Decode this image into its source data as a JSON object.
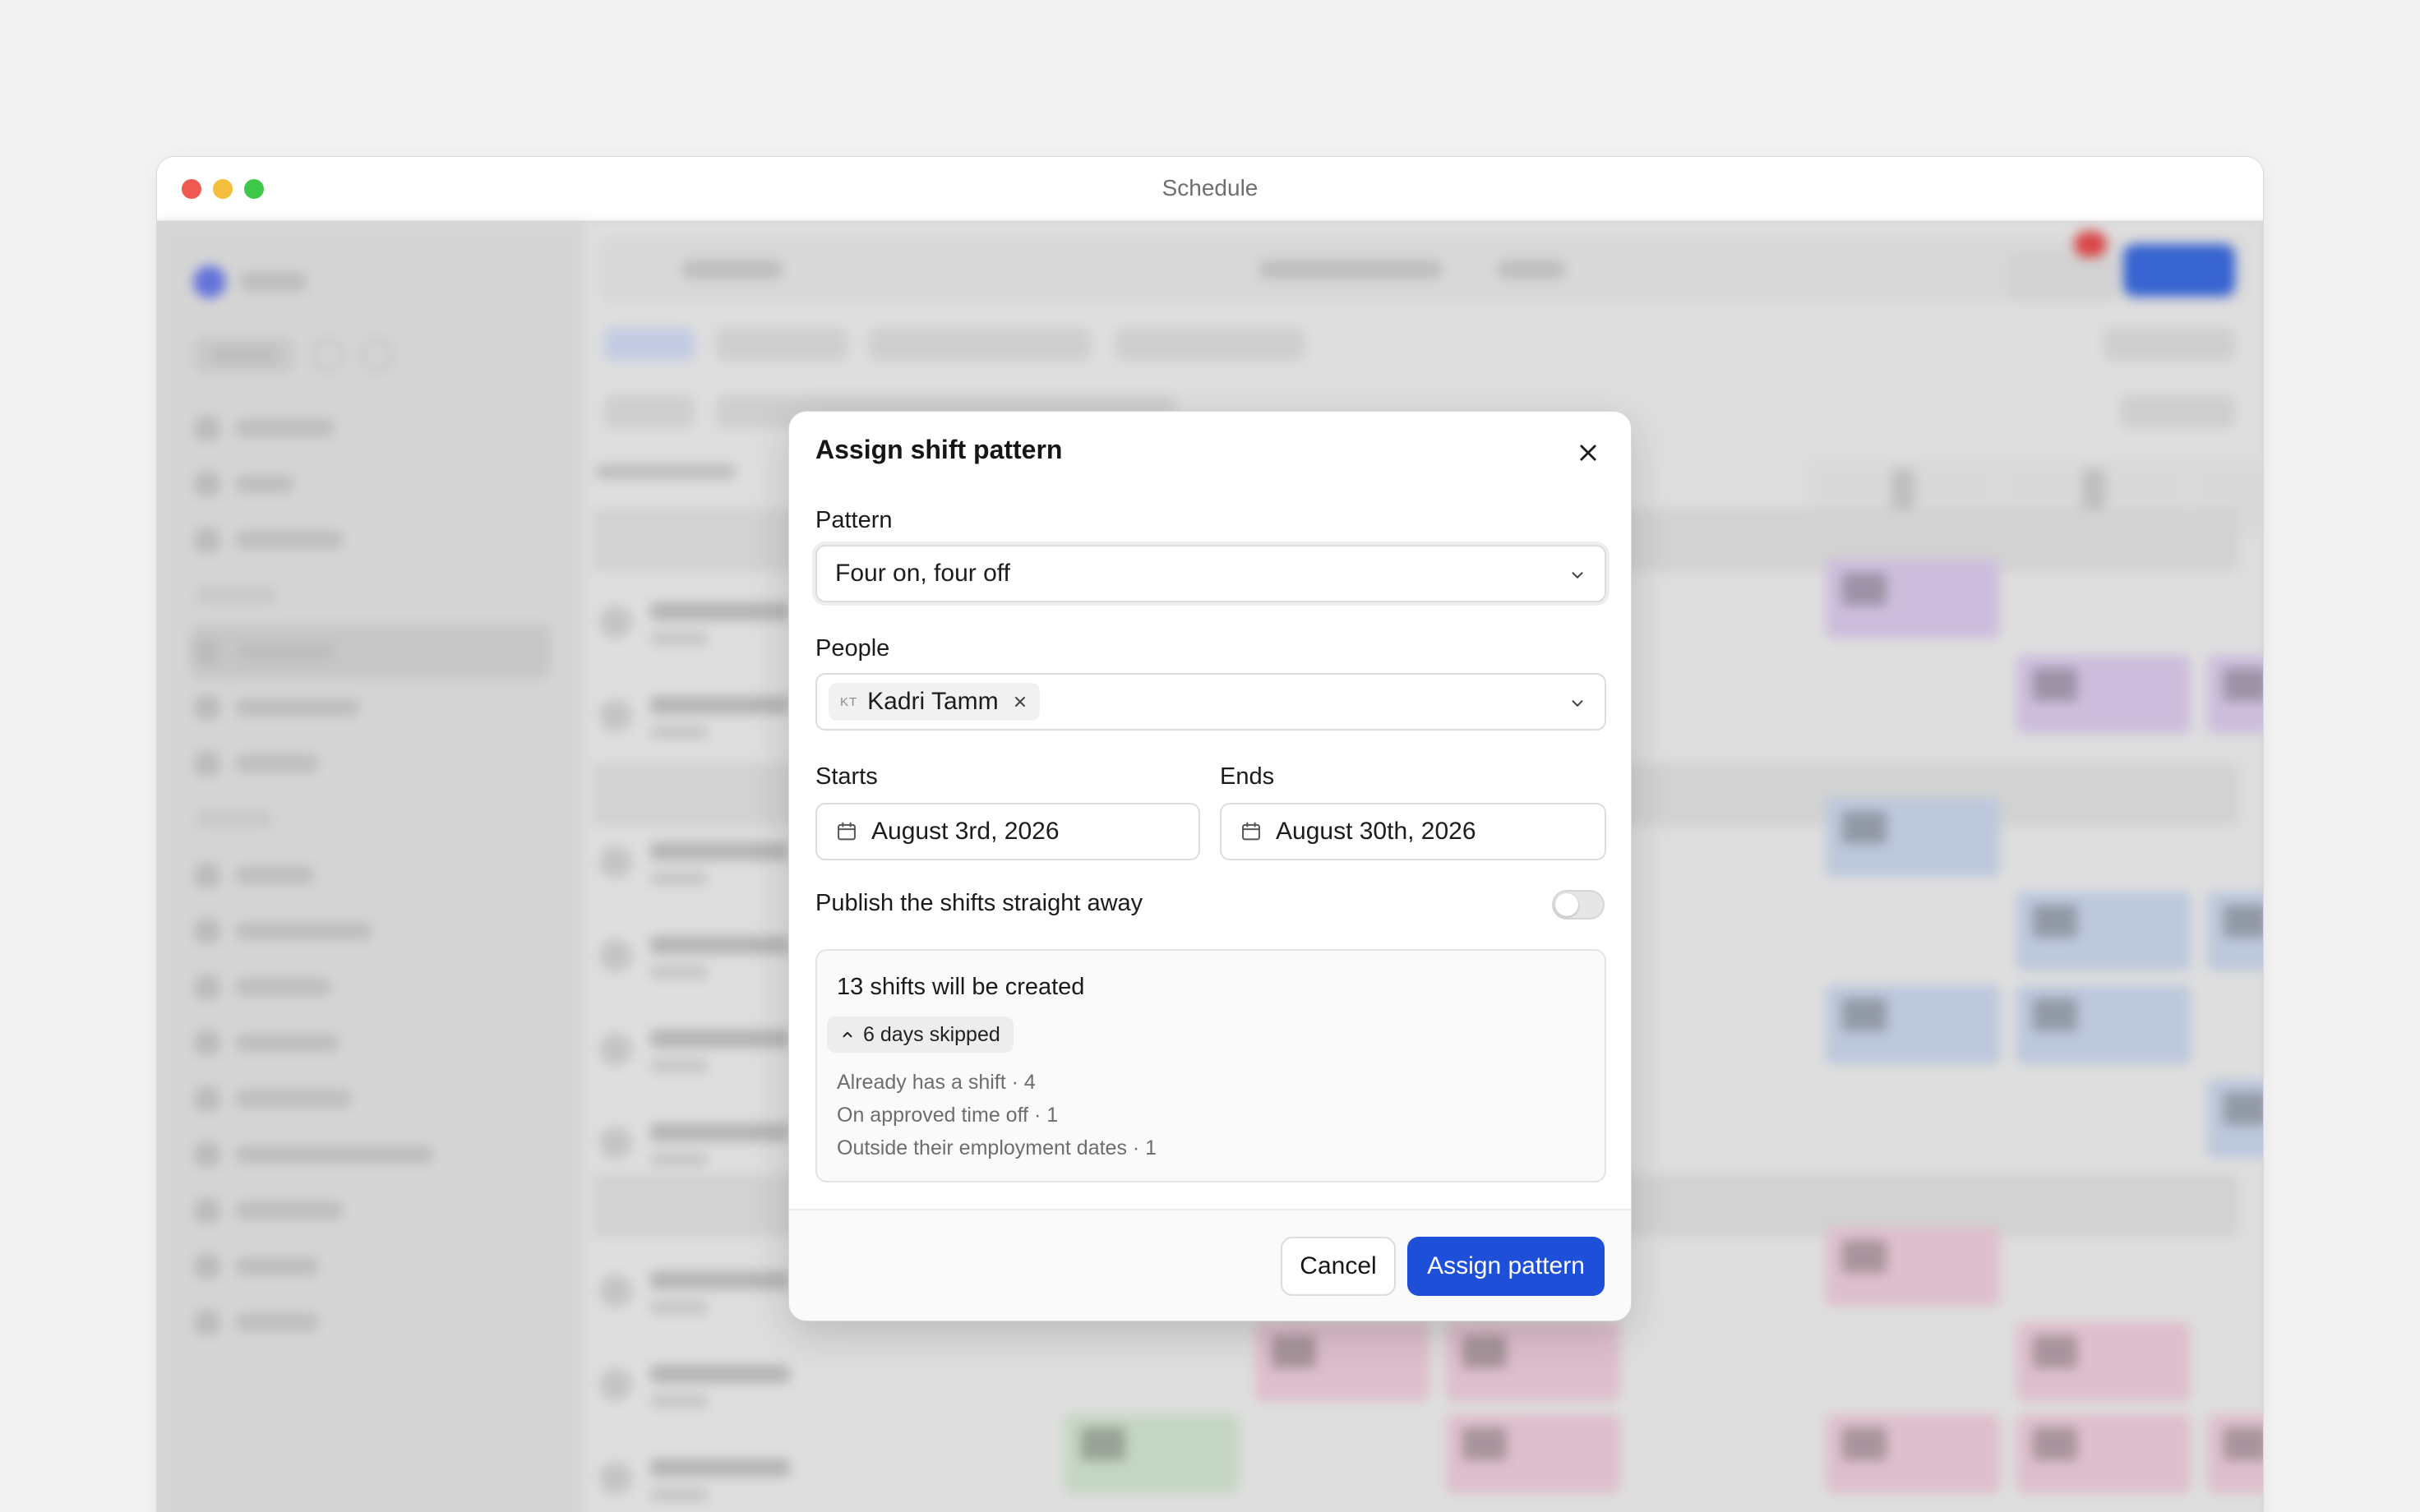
{
  "window": {
    "title": "Schedule"
  },
  "dialog": {
    "title": "Assign shift pattern",
    "pattern": {
      "label": "Pattern",
      "value": "Four on, four off"
    },
    "people": {
      "label": "People",
      "chips": [
        {
          "initials": "KT",
          "name": "Kadri Tamm"
        }
      ]
    },
    "starts": {
      "label": "Starts",
      "value": "August 3rd, 2026"
    },
    "ends": {
      "label": "Ends",
      "value": "August 30th, 2026"
    },
    "publish": {
      "label": "Publish the shifts straight away",
      "enabled": false
    },
    "summary": {
      "title": "13 shifts will be created",
      "skipped_label": "6 days skipped",
      "reasons": [
        "Already has a shift · 4",
        "On approved time off · 1",
        "Outside their employment dates · 1"
      ]
    },
    "actions": {
      "cancel": "Cancel",
      "submit": "Assign pattern"
    }
  },
  "colors": {
    "primary": "#1e4fd8",
    "background": "#f3f3f3"
  },
  "icons": {
    "close": "close-icon",
    "chevron": "chevron-down-icon",
    "calendar": "calendar-icon",
    "remove": "remove-icon",
    "expand": "chevron-up-icon"
  }
}
